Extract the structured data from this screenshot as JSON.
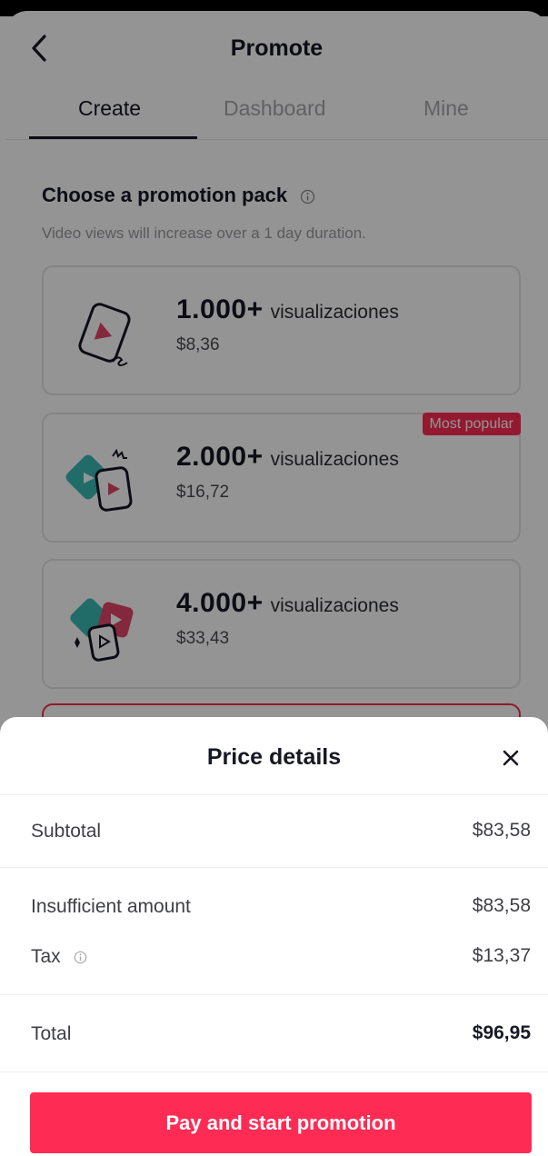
{
  "header": {
    "title": "Promote",
    "back_icon": "chevron-left-icon"
  },
  "tabs": [
    {
      "label": "Create",
      "active": true
    },
    {
      "label": "Dashboard",
      "active": false
    },
    {
      "label": "Mine",
      "active": false
    }
  ],
  "section": {
    "title": "Choose a promotion pack",
    "info_icon": "info-icon",
    "subtitle": "Video views will increase over a 1 day duration."
  },
  "packs": [
    {
      "count": "1.000+",
      "unit": "visualizaciones",
      "price": "$8,36"
    },
    {
      "count": "2.000+",
      "unit": "visualizaciones",
      "price": "$16,72",
      "badge": "Most popular"
    },
    {
      "count": "4.000+",
      "unit": "visualizaciones",
      "price": "$33,43"
    }
  ],
  "price_details": {
    "title": "Price details",
    "close_icon": "close-icon",
    "rows": [
      {
        "label": "Subtotal",
        "value": "$83,58"
      },
      {
        "label": "Insufficient amount",
        "value": "$83,58"
      },
      {
        "label": "Tax",
        "value": "$13,37"
      },
      {
        "label": "Total",
        "value": "$96,95"
      }
    ],
    "pay_button": "Pay and start promotion"
  },
  "colors": {
    "accent": "#fe2c55",
    "teal": "#39b8b6",
    "text": "#161823",
    "muted": "#a7a8ad"
  }
}
